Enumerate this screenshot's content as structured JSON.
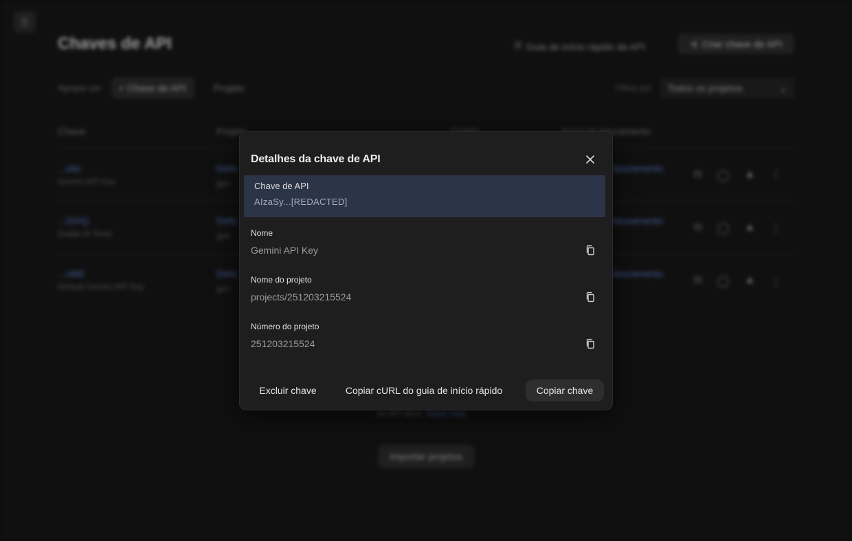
{
  "background": {
    "page_title": "Chaves de API",
    "guide_link": "Guia de início rápido da API",
    "create_button": "Criar chave de API",
    "group_by_label": "Agrupar por",
    "group_chips": [
      "Chave de API",
      "Projeto"
    ],
    "filter_label": "Filtrar por",
    "filter_value": "Todos os projetos",
    "table_headers": [
      "Chave",
      "Projeto",
      "Criado",
      "Nível de faturamento"
    ],
    "rows": [
      {
        "key": "...oilo",
        "name": "Gemini API Key",
        "project": "Defa",
        "project_sub": "gen",
        "billing": "faturamento"
      },
      {
        "key": "...DiXQ",
        "name": "Sulida IA Teste",
        "project": "Defa",
        "project_sub": "gen",
        "billing": "faturamento"
      },
      {
        "key": "...n8iE",
        "name": "Default Gemini API Key",
        "project": "Defa",
        "project_sub": "gen",
        "billing": "faturamento"
      }
    ],
    "footer_text": "de API ativa.",
    "footer_link": "Saiba mais",
    "import_button": "Importar projetos"
  },
  "dialog": {
    "title": "Detalhes da chave de API",
    "api_key_label": "Chave de API",
    "api_key_value": "AIzaSy...[REDACTED]",
    "name_label": "Nome",
    "name_value": "Gemini API Key",
    "project_name_label": "Nome do projeto",
    "project_name_value": "projects/251203215524",
    "project_number_label": "Número do projeto",
    "project_number_value": "251203215524",
    "delete_button": "Excluir chave",
    "curl_button": "Copiar cURL do guia de início rápido",
    "copy_button": "Copiar chave"
  }
}
